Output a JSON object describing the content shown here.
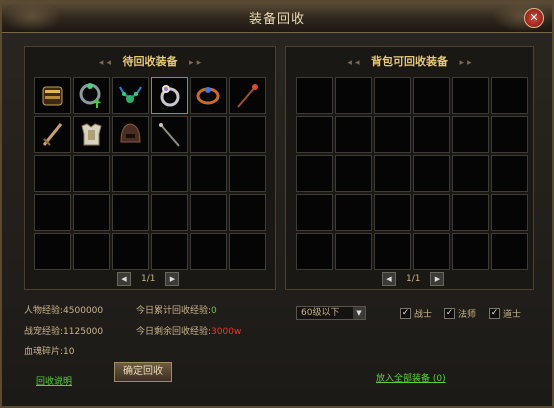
{
  "window": {
    "title": "装备回收",
    "close_glyph": "✕"
  },
  "left_panel": {
    "title": "待回收装备",
    "deco_left": "◂ ◂",
    "deco_right": "▸ ▸",
    "page": "1/1",
    "items": [
      "gold-bracelet-icon",
      "magic-ring-upgrade-icon",
      "emerald-necklace-icon",
      "silver-ring-icon",
      "copper-ring-icon",
      "red-staff-icon",
      "bronze-sword-icon",
      "white-armor-icon",
      "dark-helmet-icon",
      "thin-staff-icon"
    ]
  },
  "right_panel": {
    "title": "背包可回收装备",
    "deco_left": "◂ ◂",
    "deco_right": "▸ ▸",
    "page": "1/1"
  },
  "stats": {
    "char_exp_label": "人物经验:",
    "char_exp": "4500000",
    "today_exp_label": "今日累计回收经验:",
    "today_exp": "0",
    "pet_exp_label": "战宠经验:",
    "pet_exp": "1125000",
    "remain_exp_label": "今日剩余回收经验:",
    "remain_exp": "3000w",
    "soul_label": "血魂碎片:",
    "soul": "10"
  },
  "buttons": {
    "help": "回收说明",
    "confirm": "确定回收",
    "put_all": "放入全部装备 (0)"
  },
  "filter": {
    "level_select": "60级以下",
    "warrior": "战士",
    "mage": "法师",
    "taoist": "道士"
  },
  "colors": {
    "gold": "#e6c877",
    "green": "#58d03a",
    "red": "#e23b2e"
  }
}
